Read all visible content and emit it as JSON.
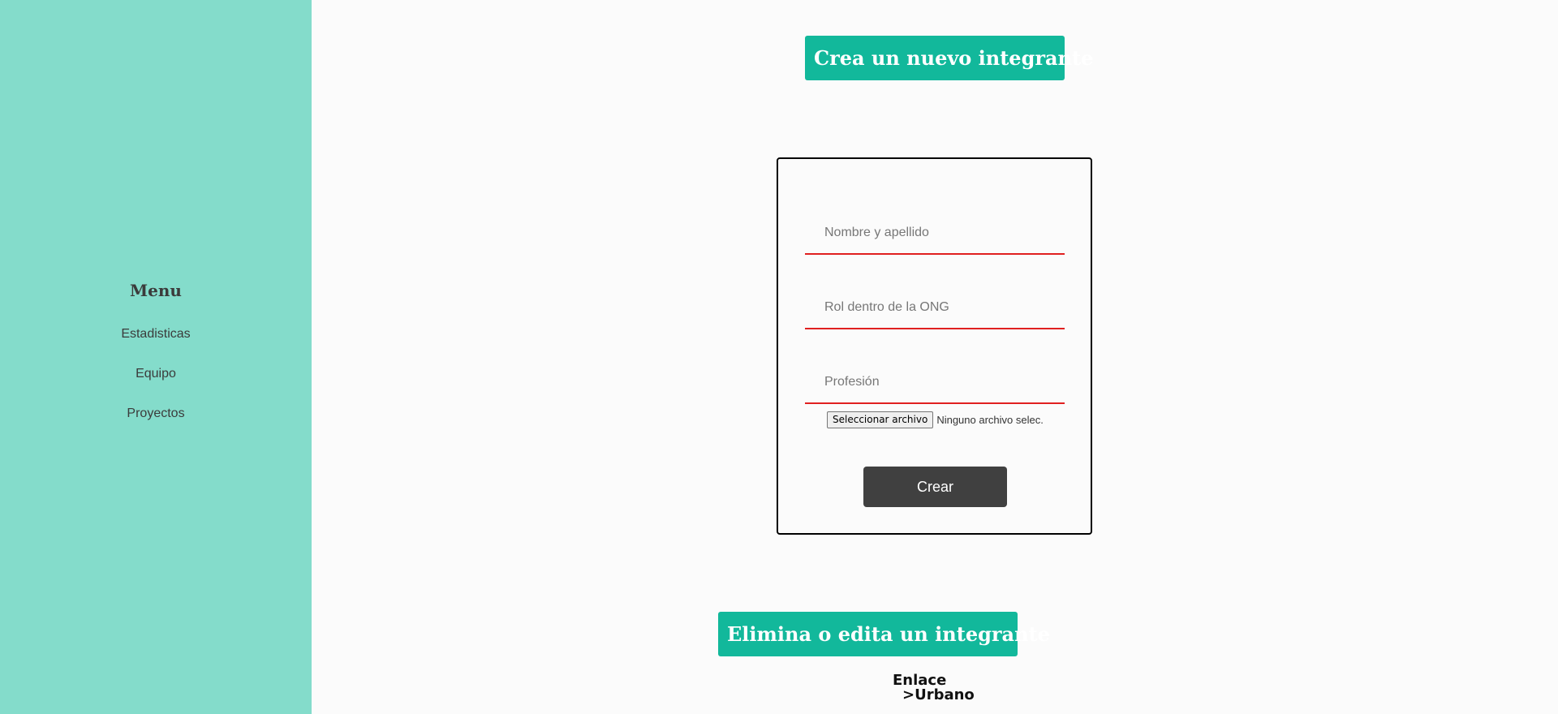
{
  "sidebar": {
    "menu_title": "Menu",
    "items": [
      {
        "label": "Estadisticas"
      },
      {
        "label": "Equipo"
      },
      {
        "label": "Proyectos"
      }
    ]
  },
  "create_section": {
    "title": "Crea un nuevo integrante",
    "fields": [
      {
        "placeholder": "Nombre y apellido",
        "value": ""
      },
      {
        "placeholder": "Rol dentro de la ONG",
        "value": ""
      },
      {
        "placeholder": "Profesión",
        "value": ""
      }
    ],
    "file_button_label": "Seleccionar archivo",
    "file_status": "Ninguno archivo selec.",
    "submit_label": "Crear"
  },
  "edit_section": {
    "title": "Elimina o edita un integrante"
  },
  "footer": {
    "logo_line1": "Enlace",
    "logo_line2": ">Urbano"
  },
  "colors": {
    "sidebar_bg": "#84dccb",
    "accent": "#12b89b",
    "field_underline": "#e02020",
    "button_bg": "#404040",
    "page_bg": "#fbfbfb"
  }
}
